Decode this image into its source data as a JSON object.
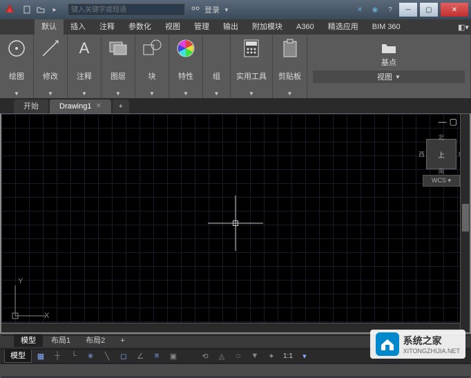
{
  "titlebar": {
    "search_placeholder": "键入关键字或短语",
    "login_label": "登录"
  },
  "ribbon_tabs": [
    "默认",
    "插入",
    "注释",
    "参数化",
    "视图",
    "管理",
    "输出",
    "附加模块",
    "A360",
    "精选应用",
    "BIM 360"
  ],
  "panels": [
    {
      "label": "绘图",
      "icon": "circle"
    },
    {
      "label": "修改",
      "icon": "move"
    },
    {
      "label": "注释",
      "icon": "text-a"
    },
    {
      "label": "图层",
      "icon": "layers"
    },
    {
      "label": "块",
      "icon": "block"
    },
    {
      "label": "特性",
      "icon": "color-wheel"
    },
    {
      "label": "组",
      "icon": "none"
    },
    {
      "label": "实用工具",
      "icon": "calculator"
    },
    {
      "label": "剪贴板",
      "icon": "clipboard"
    },
    {
      "label": "基点",
      "icon": "folder"
    }
  ],
  "panel_footer": "视图",
  "filetabs": {
    "start": "开始",
    "drawing": "Drawing1"
  },
  "viewcube": {
    "face": "上",
    "n": "北",
    "s": "南",
    "e": "东",
    "w": "西",
    "wcs": "WCS"
  },
  "ucs": {
    "x": "X",
    "y": "Y"
  },
  "layout_tabs": [
    "模型",
    "布局1",
    "布局2"
  ],
  "statusbar": {
    "model": "模型",
    "scale": "1:1"
  },
  "watermark": {
    "title": "系统之家",
    "url": "XITONGZHIJIA.NET"
  }
}
